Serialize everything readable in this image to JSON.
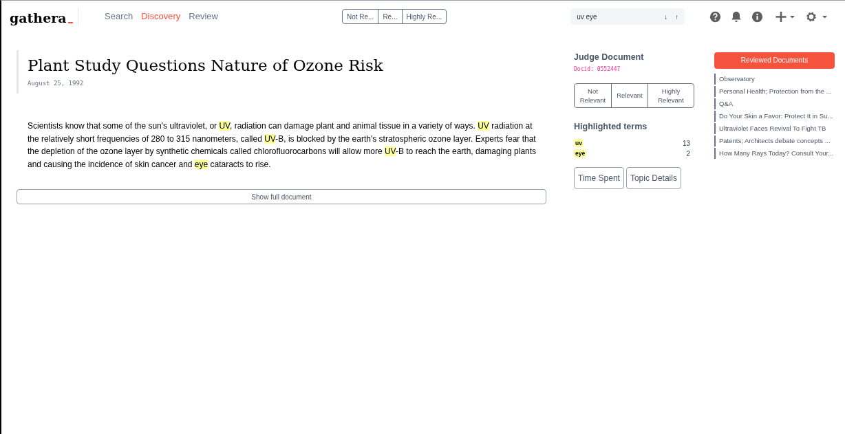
{
  "logo": {
    "text": "gathera"
  },
  "nav": [
    {
      "label": "Search",
      "selected": false
    },
    {
      "label": "Discovery",
      "selected": true
    },
    {
      "label": "Review",
      "selected": false
    }
  ],
  "top_judgments": [
    {
      "label": "Not Re..."
    },
    {
      "label": "Re..."
    },
    {
      "label": "Highly Re..."
    }
  ],
  "search": {
    "value": "uv eye",
    "prev": "↓",
    "next": "↑"
  },
  "document": {
    "title": "Plant Study Questions Nature of Ozone Risk",
    "date": "August 25, 1992",
    "body": [
      {
        "text": "Scientists know that some of the sun's ultraviolet, or ",
        "highlight": false
      },
      {
        "text": "UV",
        "highlight": true
      },
      {
        "text": ", radiation can damage plant and animal tissue in a variety of ways. ",
        "highlight": false
      },
      {
        "text": "UV",
        "highlight": true
      },
      {
        "text": " radiation at the relatively short frequencies of 280 to 315 nanometers, called ",
        "highlight": false
      },
      {
        "text": "UV",
        "highlight": true
      },
      {
        "text": "-B, is blocked by the earth's stratospheric ozone layer. Experts fear that the depletion of the ozone layer by synthetic chemicals called chlorofluorocarbons will allow more ",
        "highlight": false
      },
      {
        "text": "UV",
        "highlight": true
      },
      {
        "text": "-B to reach the earth, damaging plants and causing the incidence of skin cancer and ",
        "highlight": false
      },
      {
        "text": "eye",
        "highlight": true
      },
      {
        "text": " cataracts to rise.",
        "highlight": false
      }
    ],
    "show_full": "Show full document"
  },
  "judge": {
    "title": "Judge Document",
    "docid": "Docid: 0552447",
    "options": [
      {
        "label": "Not Relevant"
      },
      {
        "label": "Relevant"
      },
      {
        "label": "Highly Relevant"
      }
    ],
    "terms_title": "Highlighted terms",
    "terms": [
      {
        "term": "uv",
        "count": "13"
      },
      {
        "term": "eye",
        "count": "2"
      }
    ],
    "buttons": [
      "Time Spent",
      "Topic Details"
    ]
  },
  "reviewed": {
    "button": "Reviewed Documents",
    "items": [
      "Observatory",
      "Personal Health; Protection from the ...",
      "Q&A",
      "Do Your Skin a Favor: Protect It in Su...",
      "Ultraviolet Faces Revival To Fight TB",
      "Patents; Architects debate concepts ...",
      "How Many Rays Today? Consult Your..."
    ]
  }
}
